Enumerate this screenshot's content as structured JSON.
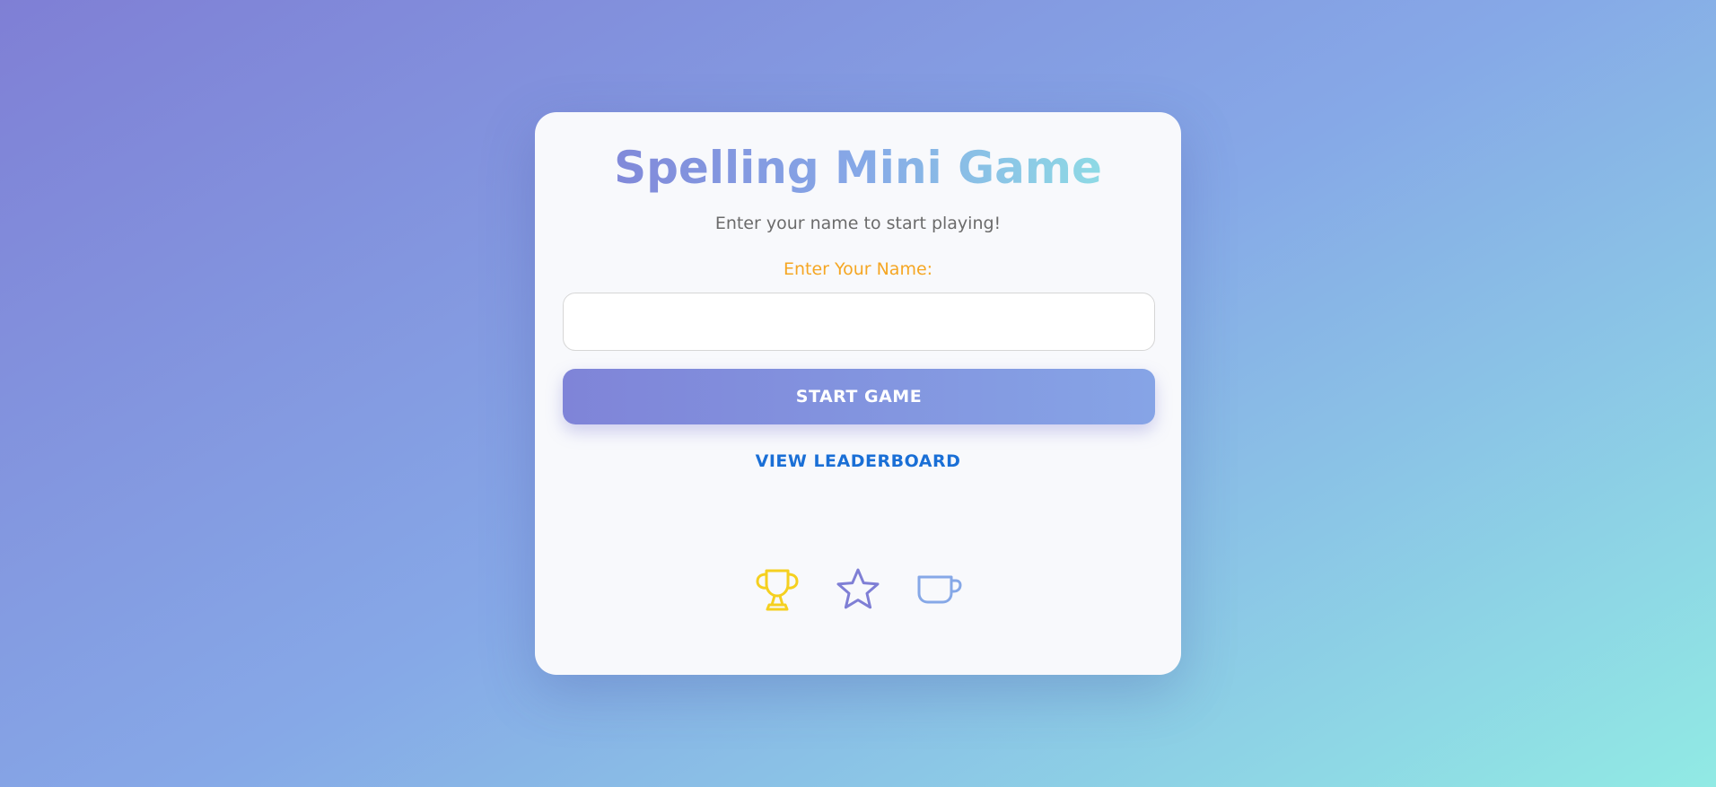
{
  "card": {
    "title": "Spelling Mini Game",
    "subtitle": "Enter your name to start playing!",
    "name_label": "Enter Your Name:",
    "name_input": {
      "value": "",
      "placeholder": ""
    },
    "start_button_label": "START GAME",
    "leaderboard_link_label": "VIEW LEADERBOARD"
  },
  "decor_icons": [
    {
      "name": "trophy-icon",
      "color": "#f5d020"
    },
    {
      "name": "star-icon",
      "color": "#7f7fd5"
    },
    {
      "name": "cup-icon",
      "color": "#86a8e7"
    }
  ],
  "colors": {
    "gradient_start": "#7f7fd5",
    "gradient_mid": "#86a8e7",
    "gradient_end": "#91eae4",
    "label_accent": "#f5a623",
    "link": "#1a6fd6"
  }
}
